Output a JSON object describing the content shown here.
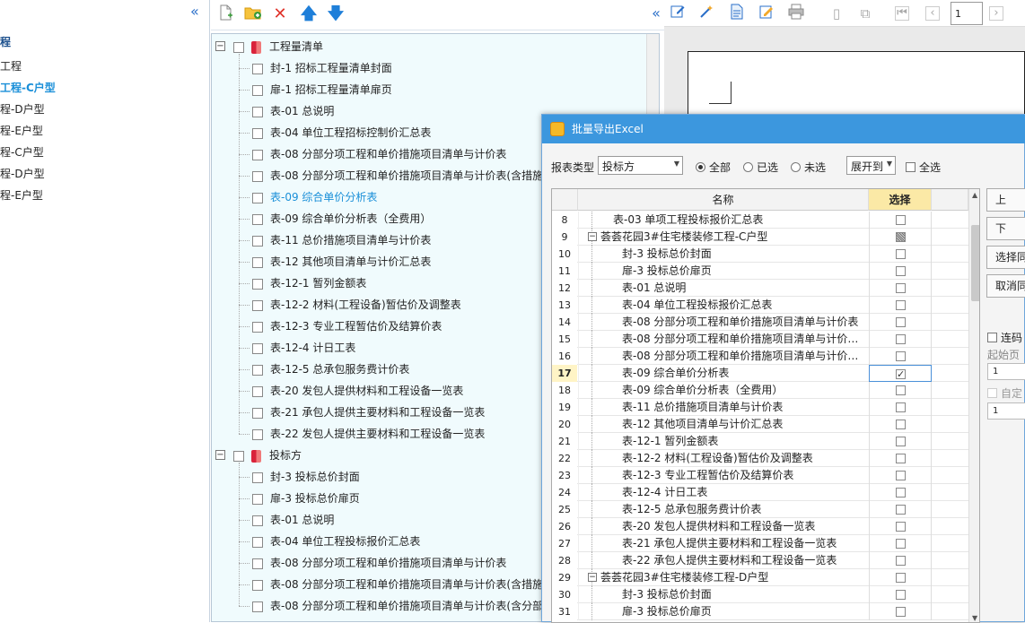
{
  "left_tree": {
    "items": [
      {
        "label": "程",
        "style": "bold"
      },
      {
        "label": "工程",
        "style": "normal"
      },
      {
        "label": "工程-C户型",
        "style": "active"
      },
      {
        "label": "程-D户型",
        "style": "normal"
      },
      {
        "label": "程-E户型",
        "style": "normal"
      },
      {
        "label": "程-C户型",
        "style": "normal"
      },
      {
        "label": "程-D户型",
        "style": "normal"
      },
      {
        "label": "程-E户型",
        "style": "normal"
      }
    ]
  },
  "report_toolbar": {
    "icons": [
      "new-file-icon",
      "add-folder-icon",
      "delete-icon",
      "move-up-icon",
      "move-down-icon"
    ]
  },
  "report_tree": {
    "groups": [
      {
        "label": "工程量清单",
        "children": [
          "封-1 招标工程量清单封面",
          "扉-1 招标工程量清单扉页",
          "表-01 总说明",
          "表-04 单位工程招标控制价汇总表",
          "表-08 分部分项工程和单价措施项目清单与计价表",
          "表-08 分部分项工程和单价措施项目清单与计价表(含措施",
          "表-09 综合单价分析表",
          "表-09 综合单价分析表（全费用）",
          "表-11 总价措施项目清单与计价表",
          "表-12 其他项目清单与计价汇总表",
          "表-12-1 暂列金额表",
          "表-12-2 材料(工程设备)暂估价及调整表",
          "表-12-3 专业工程暂估价及结算价表",
          "表-12-4 计日工表",
          "表-12-5 总承包服务费计价表",
          "表-20 发包人提供材料和工程设备一览表",
          "表-21 承包人提供主要材料和工程设备一览表",
          "表-22 发包人提供主要材料和工程设备一览表"
        ]
      },
      {
        "label": "投标方",
        "children": [
          "封-3 投标总价封面",
          "扉-3 投标总价扉页",
          "表-01 总说明",
          "表-04 单位工程投标报价汇总表",
          "表-08 分部分项工程和单价措施项目清单与计价表",
          "表-08 分部分项工程和单价措施项目清单与计价表(含措施",
          "表-08 分部分项工程和单价措施项目清单与计价表(含分部"
        ]
      }
    ],
    "selected_item": "表-09 综合单价分析表"
  },
  "preview_toolbar": {
    "icons": [
      "edit-icon",
      "magic-wand-icon",
      "document-icon",
      "pencil-note-icon",
      "print-icon",
      "page-icon",
      "copy-page-icon",
      "first-page-icon",
      "previous-page-icon",
      "next-page-icon"
    ],
    "page_number": "1"
  },
  "dialog": {
    "title": "批量导出Excel",
    "report_type_label": "报表类型",
    "report_type_value": "投标方",
    "radio_all": "全部",
    "radio_selected": "已选",
    "radio_unselected": "未选",
    "expand_label": "展开到",
    "select_all_label": "全选",
    "col_name": "名称",
    "col_select": "选择",
    "rows": [
      {
        "num": "8",
        "name": "表-03 单项工程投标报价汇总表",
        "level": 1,
        "state": "none"
      },
      {
        "num": "9",
        "name": "荟荟花园3#住宅楼装修工程-C户型",
        "level": 1,
        "state": "partial",
        "group": true
      },
      {
        "num": "10",
        "name": "封-3 投标总价封面",
        "level": 2,
        "state": "none"
      },
      {
        "num": "11",
        "name": "扉-3 投标总价扉页",
        "level": 2,
        "state": "none"
      },
      {
        "num": "12",
        "name": "表-01 总说明",
        "level": 2,
        "state": "none"
      },
      {
        "num": "13",
        "name": "表-04 单位工程投标报价汇总表",
        "level": 2,
        "state": "none"
      },
      {
        "num": "14",
        "name": "表-08 分部分项工程和单价措施项目清单与计价表",
        "level": 2,
        "state": "none"
      },
      {
        "num": "15",
        "name": "表-08 分部分项工程和单价措施项目清单与计价…",
        "level": 2,
        "state": "none"
      },
      {
        "num": "16",
        "name": "表-08 分部分项工程和单价措施项目清单与计价…",
        "level": 2,
        "state": "none"
      },
      {
        "num": "17",
        "name": "表-09 综合单价分析表",
        "level": 2,
        "state": "checked",
        "current": true
      },
      {
        "num": "18",
        "name": "表-09 综合单价分析表（全费用）",
        "level": 2,
        "state": "none"
      },
      {
        "num": "19",
        "name": "表-11 总价措施项目清单与计价表",
        "level": 2,
        "state": "none"
      },
      {
        "num": "20",
        "name": "表-12 其他项目清单与计价汇总表",
        "level": 2,
        "state": "none"
      },
      {
        "num": "21",
        "name": "表-12-1 暂列金额表",
        "level": 2,
        "state": "none"
      },
      {
        "num": "22",
        "name": "表-12-2 材料(工程设备)暂估价及调整表",
        "level": 2,
        "state": "none"
      },
      {
        "num": "23",
        "name": "表-12-3 专业工程暂估价及结算价表",
        "level": 2,
        "state": "none"
      },
      {
        "num": "24",
        "name": "表-12-4 计日工表",
        "level": 2,
        "state": "none"
      },
      {
        "num": "25",
        "name": "表-12-5 总承包服务费计价表",
        "level": 2,
        "state": "none"
      },
      {
        "num": "26",
        "name": "表-20 发包人提供材料和工程设备一览表",
        "level": 2,
        "state": "none"
      },
      {
        "num": "27",
        "name": "表-21 承包人提供主要材料和工程设备一览表",
        "level": 2,
        "state": "none"
      },
      {
        "num": "28",
        "name": "表-22 承包人提供主要材料和工程设备一览表",
        "level": 2,
        "state": "none"
      },
      {
        "num": "29",
        "name": "荟荟花园3#住宅楼装修工程-D户型",
        "level": 1,
        "state": "none",
        "group": true
      },
      {
        "num": "30",
        "name": "封-3 投标总价封面",
        "level": 2,
        "state": "none"
      },
      {
        "num": "31",
        "name": "扉-3 投标总价扉页",
        "level": 2,
        "state": "none"
      }
    ],
    "side_buttons": [
      "上",
      "下",
      "选择同",
      "取消同"
    ],
    "side_options": {
      "continuous_label": "连码",
      "start_page_label": "起始页",
      "start_page_value": "1",
      "custom_label": "自定",
      "custom_value": "1"
    }
  }
}
